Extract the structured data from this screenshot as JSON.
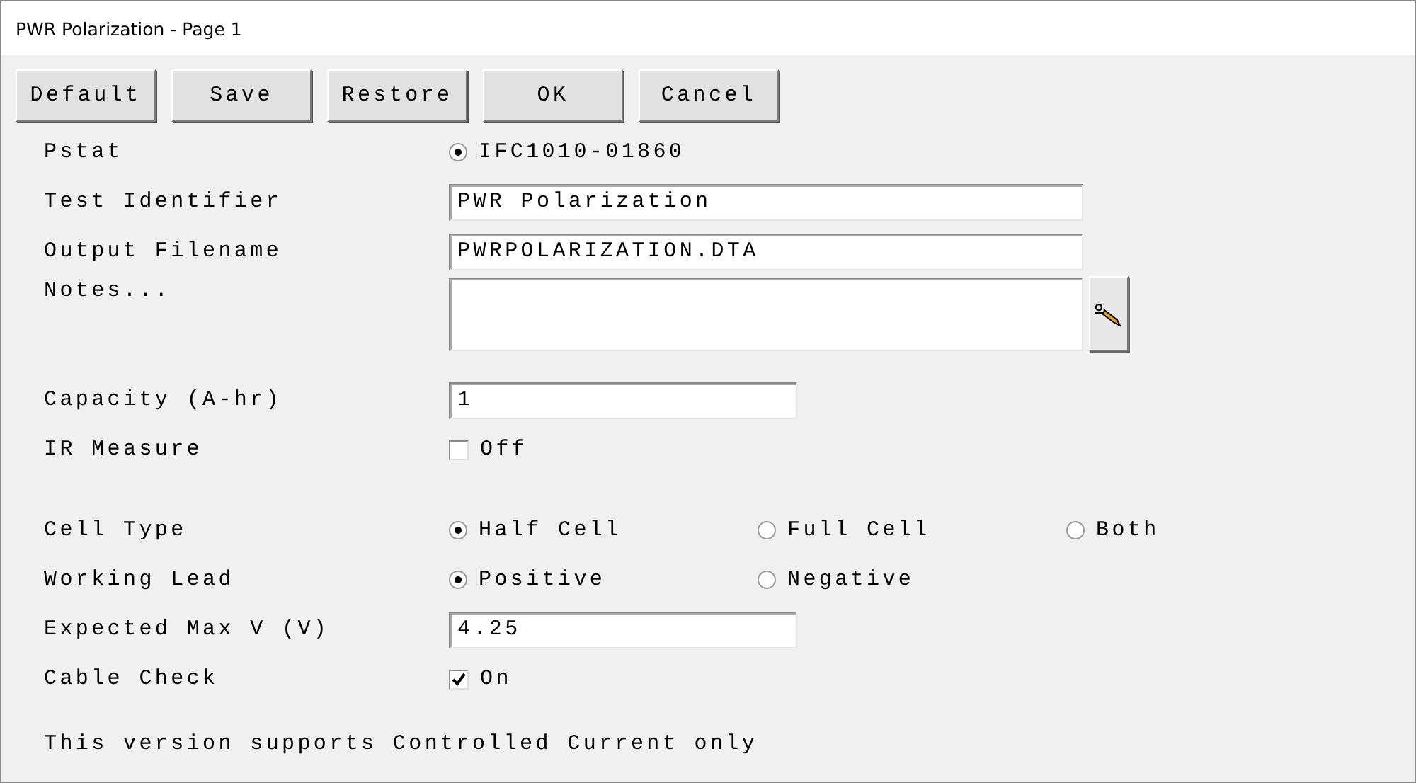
{
  "window": {
    "title": "PWR Polarization - Page 1"
  },
  "buttons": [
    "Default",
    "Save",
    "Restore",
    "OK",
    "Cancel"
  ],
  "sections": [
    {
      "rows": [
        {
          "kind": "radio",
          "label": "Pstat",
          "options": [
            {
              "label": "IFC1010-01860",
              "selected": true
            }
          ]
        },
        {
          "kind": "text",
          "label": "Test Identifier",
          "value": "PWR Polarization"
        },
        {
          "kind": "text",
          "label": "Output Filename",
          "value": "PWRPOLARIZATION.DTA"
        },
        {
          "kind": "notes",
          "label": "Notes..."
        },
        {
          "kind": "number",
          "label": "Capacity (A-hr)",
          "value": "1"
        },
        {
          "kind": "checkbox",
          "label": "IR Measure",
          "checked": false,
          "text": "Off"
        }
      ]
    },
    {
      "rows": [
        {
          "kind": "radio",
          "label": "Cell Type",
          "options": [
            {
              "label": "Half Cell",
              "selected": true
            },
            {
              "label": "Full Cell",
              "selected": false
            },
            {
              "label": "Both",
              "selected": false
            }
          ]
        },
        {
          "kind": "radio",
          "label": "Working Lead",
          "options": [
            {
              "label": "Positive",
              "selected": true
            },
            {
              "label": "Negative",
              "selected": false
            }
          ]
        },
        {
          "kind": "number",
          "label": "Expected Max V (V)",
          "value": "4.25"
        },
        {
          "kind": "checkbox",
          "label": "Cable Check",
          "checked": true,
          "text": "On"
        }
      ]
    }
  ],
  "footer_note": "This version supports Controlled Current only"
}
